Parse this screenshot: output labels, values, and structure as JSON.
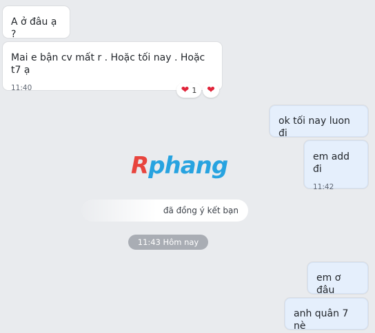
{
  "messages": {
    "m1": {
      "text": "A ở đâu ạ ?"
    },
    "m2": {
      "text": "Mai e bận cv mất r . Hoặc tối nay . Hoặc t7 ạ",
      "time": "11:40",
      "reactions": {
        "count": "1"
      }
    },
    "m3": {
      "text": "ok tối nay luon đi"
    },
    "m4": {
      "text": "em add đi",
      "time": "11:42"
    },
    "m5": {
      "text": "em ơ đâu"
    },
    "m6": {
      "text": "anh quân 7 nè"
    }
  },
  "watermark": {
    "first": "R",
    "rest": "phang"
  },
  "system_notice": {
    "text": "đã đồng ý kết bạn"
  },
  "date_separator": {
    "text": "11:43 Hôm nay"
  },
  "colors": {
    "incoming_bubble": "#ffffff",
    "outgoing_bubble": "#e5effc",
    "heart": "#e0243a",
    "chip": "#a9adb4"
  },
  "icons": {
    "reaction": "heart-icon"
  }
}
